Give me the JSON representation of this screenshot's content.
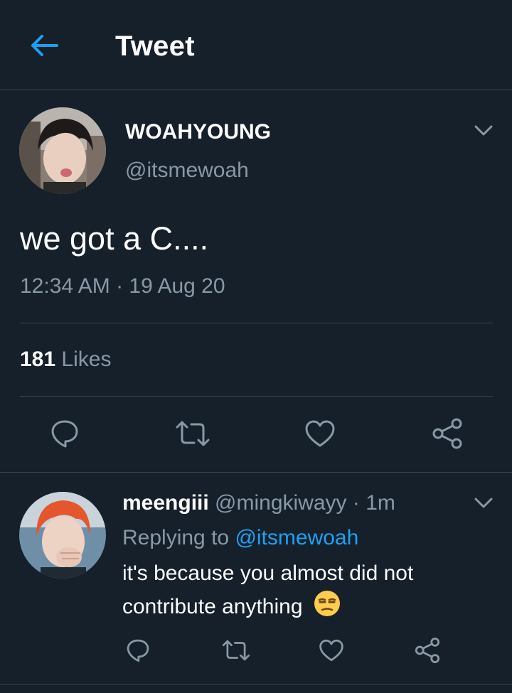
{
  "header": {
    "title": "Tweet",
    "back_icon": "arrow-left-icon"
  },
  "colors": {
    "background": "#15202b",
    "accent": "#1da1f2",
    "secondary_text": "#8899a6",
    "divider": "#38444d"
  },
  "tweet": {
    "display_name": "WOAHYOUNG",
    "handle": "@itsmewoah",
    "text": "we got a C....",
    "timestamp": "12:34 AM · 19 Aug 20",
    "likes_count": "181",
    "likes_label": "Likes",
    "actions": [
      "comment-icon",
      "retweet-icon",
      "heart-icon",
      "share-icon"
    ]
  },
  "reply": {
    "display_name": "meengiii",
    "handle_time": "@mingkiwayy · 1m",
    "replying_prefix": "Replying to",
    "replying_mention": "@itsmewoah",
    "text": "it's because you almost did not contribute anything",
    "emoji": "unamused-face-icon",
    "actions": [
      "comment-icon",
      "retweet-icon",
      "heart-icon",
      "share-icon"
    ]
  }
}
